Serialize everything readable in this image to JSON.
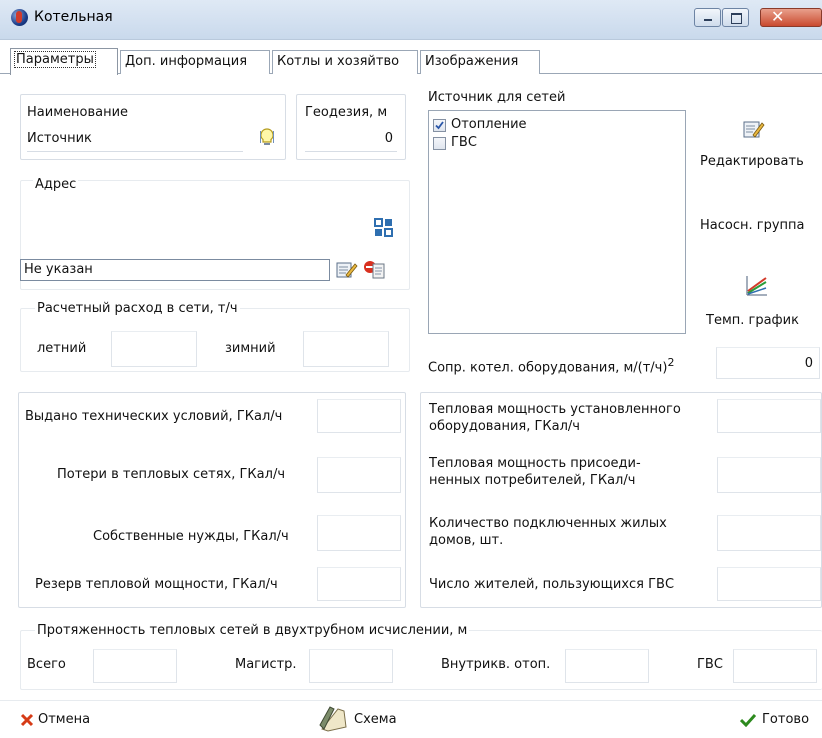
{
  "window": {
    "title": "Котельная"
  },
  "tabs": [
    "Параметры",
    "Доп. информация",
    "Котлы и хозяйтво",
    "Изображения"
  ],
  "params": {
    "name_label": "Наименование",
    "name_value": "Источник",
    "geodesy_label": "Геодезия, м",
    "geodesy_value": "0",
    "address_label": "Адрес",
    "address_value": "Не указан",
    "flow_label": "Расчетный расход в сети, т/ч",
    "summer_label": "летний",
    "winter_label": "зимний",
    "source_label": "Источник для сетей",
    "sources": [
      {
        "label": "Отопление",
        "checked": true
      },
      {
        "label": "ГВС",
        "checked": false
      }
    ],
    "edit_label": "Редактировать",
    "pump_label": "Насосн. группа",
    "temp_label": "Темп. график",
    "resistance_label": "Сопр. котел. оборудования, м/(т/ч)",
    "resistance_sup": "2",
    "resistance_value": "0"
  },
  "left_stats": [
    "Выдано технических условий, ГКал/ч",
    "Потери в тепловых сетях, ГКал/ч",
    "Собственные нужды, ГКал/ч",
    "Резерв тепловой мощности, ГКал/ч"
  ],
  "right_stats": [
    [
      "Тепловая мощность установленного",
      "оборудования, ГКал/ч"
    ],
    [
      "Тепловая мощность присоеди-",
      "ненных потребителей, ГКал/ч"
    ],
    [
      "Количество подключенных жилых",
      "домов, шт."
    ],
    [
      "Число жителей, пользующихся ГВС",
      ""
    ]
  ],
  "length": {
    "label": "Протяженность тепловых сетей в двухтрубном исчислении, м",
    "total": "Всего",
    "main": "Магистр.",
    "inner": "Внутрикв. отоп.",
    "hot": "ГВС"
  },
  "footer": {
    "cancel": "Отмена",
    "scheme": "Схема",
    "ready": "Готово"
  },
  "colors": {
    "titlebar": "#d3e0f0",
    "close": "#c94a2f",
    "accent_green": "#2d8a1e",
    "cancel_red": "#d63b16"
  }
}
